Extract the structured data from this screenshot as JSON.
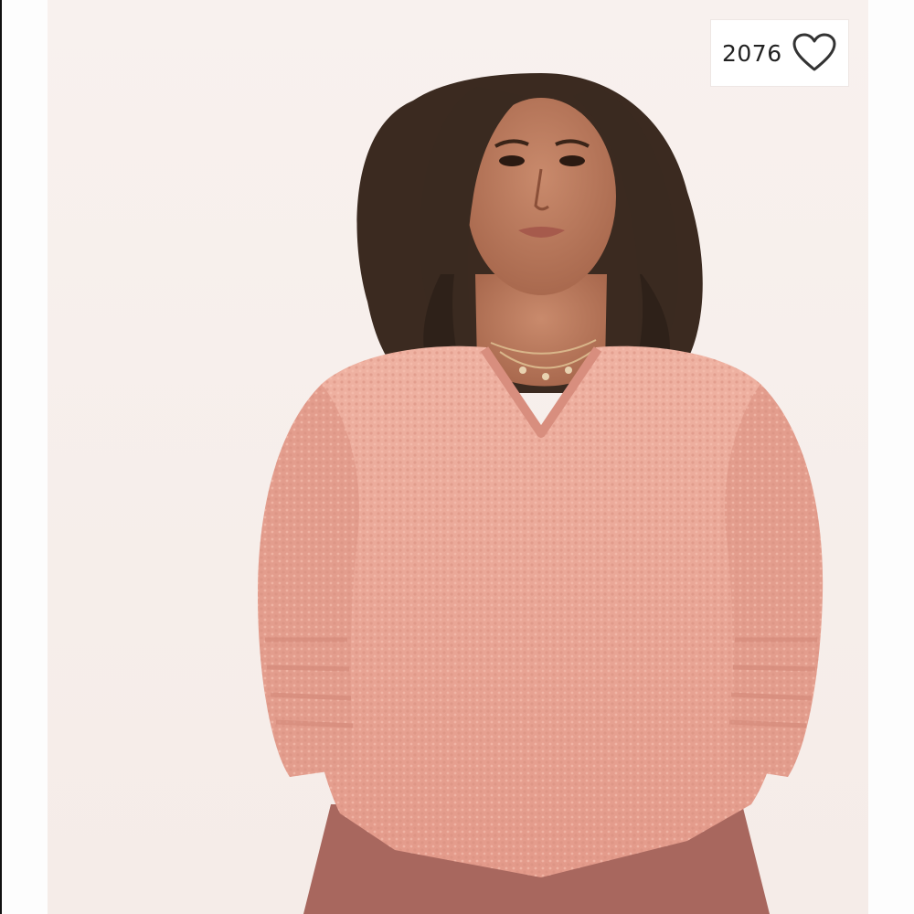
{
  "listing": {
    "like_count": "2076",
    "like_icon": "heart-outline-icon",
    "photo_subject": "woman-in-pink-sweater"
  },
  "colors": {
    "background": "#f7f1ee",
    "sweater": "#e9a898",
    "hair": "#3a2a20",
    "skirt": "#a8675e",
    "icon": "#333333"
  }
}
